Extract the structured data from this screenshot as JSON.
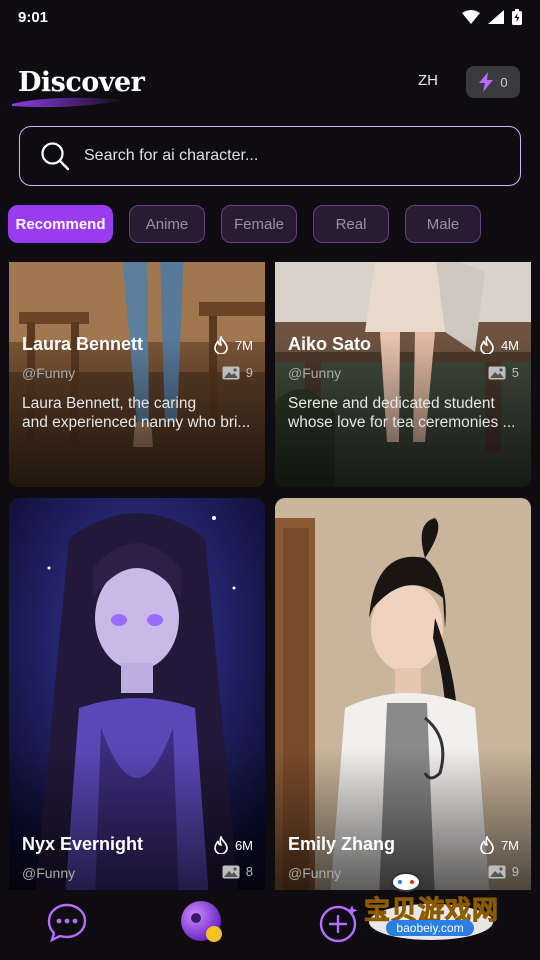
{
  "status": {
    "time": "9:01"
  },
  "header": {
    "title": "Discover",
    "lang": "ZH",
    "energy": "0"
  },
  "search": {
    "placeholder": "Search for ai character..."
  },
  "chips": [
    "Recommend",
    "Anime",
    "Female",
    "Real",
    "Male"
  ],
  "cards": [
    {
      "name": "Laura Bennett",
      "handle": "@Funny",
      "hot": "7M",
      "images": "9",
      "desc1": "Laura Bennett, the caring",
      "desc2": "and experienced nanny who bri..."
    },
    {
      "name": "Aiko Sato",
      "handle": "@Funny",
      "hot": "4M",
      "images": "5",
      "desc1": "Serene and dedicated student",
      "desc2": "whose love for tea ceremonies ..."
    },
    {
      "name": "Nyx Evernight",
      "handle": "@Funny",
      "hot": "6M",
      "images": "8"
    },
    {
      "name": "Emily Zhang",
      "handle": "@Funny",
      "hot": "7M",
      "images": "9"
    }
  ],
  "watermark": {
    "title": "宝贝游戏网",
    "url": "baobeiy.com"
  },
  "colors": {
    "accent": "#9b3cf0",
    "search_border": "#cdb7ff",
    "chip_border": "#6a3d8f"
  },
  "icons": [
    "search-icon",
    "lightning-icon",
    "fire-icon",
    "image-icon",
    "chat-icon",
    "orb-icon",
    "add-icon"
  ]
}
